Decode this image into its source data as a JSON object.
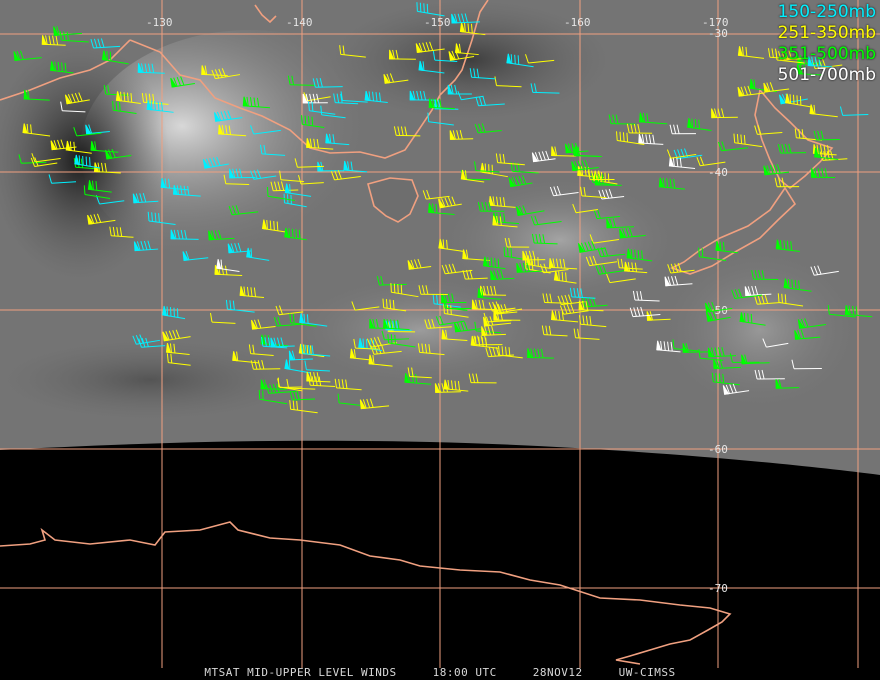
{
  "legend": [
    {
      "label": "150-250mb",
      "color": "#00f0ff"
    },
    {
      "label": "251-350mb",
      "color": "#ffff00"
    },
    {
      "label": "351-500mb",
      "color": "#00ff00"
    },
    {
      "label": "501-700mb",
      "color": "#ffffff"
    }
  ],
  "grid": {
    "longitudes": [
      "-130",
      "-140",
      "-150",
      "-160",
      "-170"
    ],
    "latitudes": [
      "-30",
      "-40",
      "-50",
      "-60",
      "-70"
    ],
    "line_color": "#f0a080"
  },
  "caption": {
    "product": "MTSAT MID-UPPER LEVEL WINDS",
    "time": "18:00 UTC",
    "date": "28NOV12",
    "source": "UW-CIMSS"
  },
  "colors": {
    "coastline": "#f0a080",
    "background_dark": "#000000",
    "imagery_gray": "#7a7a7a"
  }
}
